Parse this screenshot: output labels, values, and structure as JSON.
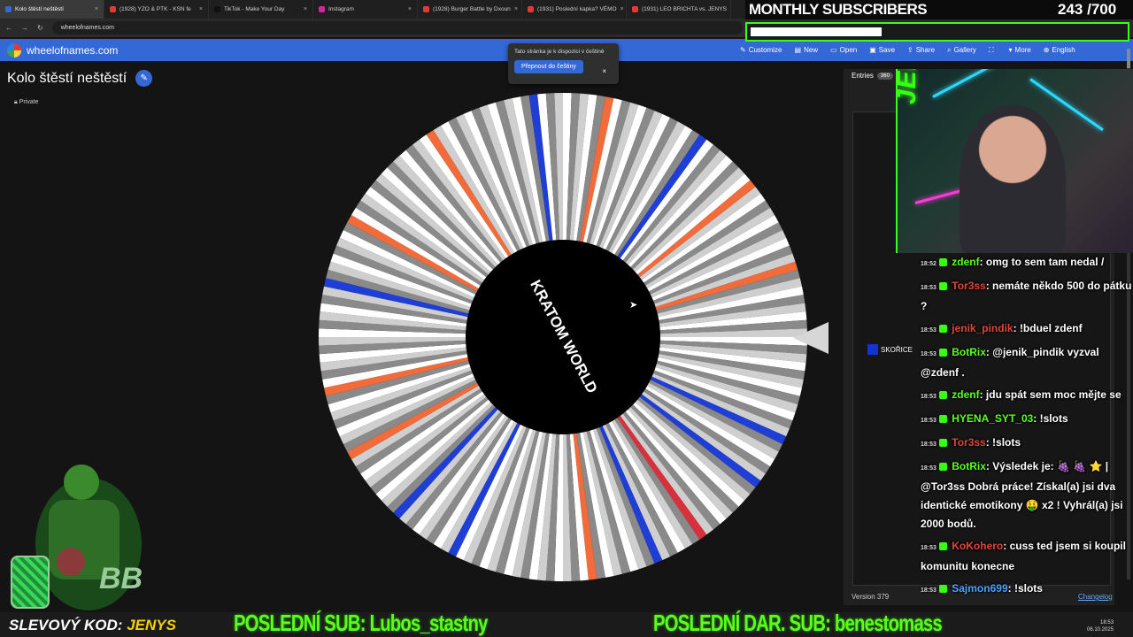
{
  "browser": {
    "tabs": [
      {
        "label": "Kolo štěstí neštěstí",
        "active": true,
        "color": "#3368d6"
      },
      {
        "label": "(1928) YZO & PTK - KSN fe",
        "active": false,
        "color": "#e53935"
      },
      {
        "label": "TikTok - Make Your Day",
        "active": false,
        "color": "#111111"
      },
      {
        "label": "Instagram",
        "active": false,
        "color": "#d6249f"
      },
      {
        "label": "(1928) Burger Battle by Dxoun",
        "active": false,
        "color": "#e53935"
      },
      {
        "label": "(1931) Poslední kapka? VÉMO",
        "active": false,
        "color": "#e53935"
      },
      {
        "label": "(1931) LEO BRICHTA vs. JENYS",
        "active": false,
        "color": "#e53935"
      }
    ],
    "url": "wheelofnames.com"
  },
  "app": {
    "site_name": "wheelofnames.com",
    "menu": [
      {
        "label": "Customize",
        "icon": "palette-icon",
        "glyph": "✎"
      },
      {
        "label": "New",
        "icon": "new-file-icon",
        "glyph": "▤"
      },
      {
        "label": "Open",
        "icon": "folder-icon",
        "glyph": "▭"
      },
      {
        "label": "Save",
        "icon": "save-icon",
        "glyph": "▣"
      },
      {
        "label": "Share",
        "icon": "share-icon",
        "glyph": "⇪"
      },
      {
        "label": "Gallery",
        "icon": "search-icon",
        "glyph": "⌕"
      },
      {
        "label": "",
        "icon": "fullscreen-icon",
        "glyph": "⛶"
      },
      {
        "label": "More",
        "icon": "more-icon",
        "glyph": "▾"
      },
      {
        "label": "English",
        "icon": "globe-icon",
        "glyph": "⊕"
      }
    ],
    "tooltip": {
      "text": "Tato stránka je k dispozici v češtině",
      "button": "Přepnout do češtiny",
      "close": "×"
    },
    "wheel_title": "Kolo štěstí neštěstí",
    "privacy": "Private",
    "wheel_center_text": "KRATOM WORLD",
    "colors": {
      "accent": "#3368d6",
      "slice_orange": "#f26b3a",
      "slice_blue": "#1f3ed6",
      "slice_red": "#d9303e"
    }
  },
  "entries_panel": {
    "tab_label": "Entries",
    "count": "360",
    "visible_entry": "SKOŘICE",
    "version": "Version 379",
    "changelog": "Changelog"
  },
  "stream": {
    "subs_label": "MONTHLY SUBSCRIBERS",
    "subs_count": "243",
    "subs_goal": "/700",
    "subs_progress": 0.347,
    "brand": "JENYSS",
    "chat": [
      {
        "time": "18:52",
        "user": "zdenf",
        "user_color": "#5aff1e",
        "msg": ": omg to sem tam nedal /"
      },
      {
        "time": "18:53",
        "user": "Tor3ss",
        "user_color": "#e0463a",
        "msg": ": nemáte někdo 500 do pátku ?"
      },
      {
        "time": "18:53",
        "user": "jenik_pindik",
        "user_color": "#e0463a",
        "msg": ": !bduel zdenf"
      },
      {
        "time": "18:53",
        "user": "BotRix",
        "user_color": "#5aff1e",
        "msg": ": @jenik_pindik vyzval @zdenf ."
      },
      {
        "time": "18:53",
        "user": "zdenf",
        "user_color": "#5aff1e",
        "msg": ": jdu spát sem moc mějte se"
      },
      {
        "time": "18:53",
        "user": "HYENA_SYT_03",
        "user_color": "#5aff1e",
        "msg": ": !slots"
      },
      {
        "time": "18:53",
        "user": "Tor3ss",
        "user_color": "#e0463a",
        "msg": ": !slots"
      },
      {
        "time": "18:53",
        "user": "BotRix",
        "user_color": "#5aff1e",
        "msg": ": Výsledek je: 🍇 🍇 ⭐ | @Tor3ss Dobrá práce! Získal(a) jsi dva identické emotikony 🤑 x2 ! Vyhrál(a) jsi 2000 bodů."
      },
      {
        "time": "18:53",
        "user": "KoKohero",
        "user_color": "#e0463a",
        "msg": ": cuss ted jsem si koupil komunitu konecne"
      },
      {
        "time": "18:53",
        "user": "Sajmon699",
        "user_color": "#4fa3ff",
        "msg": ": !slots"
      }
    ],
    "promo_prefix": "SLEVOVÝ KOD:",
    "promo_code": "JENYS",
    "last_sub": "POSLEDNÍ SUB: Lubos_stastny",
    "last_gift_sub": "POSLEDNÍ DAR. SUB: benestomass",
    "clock_time": "18:53",
    "clock_date": "06.10.2025"
  }
}
